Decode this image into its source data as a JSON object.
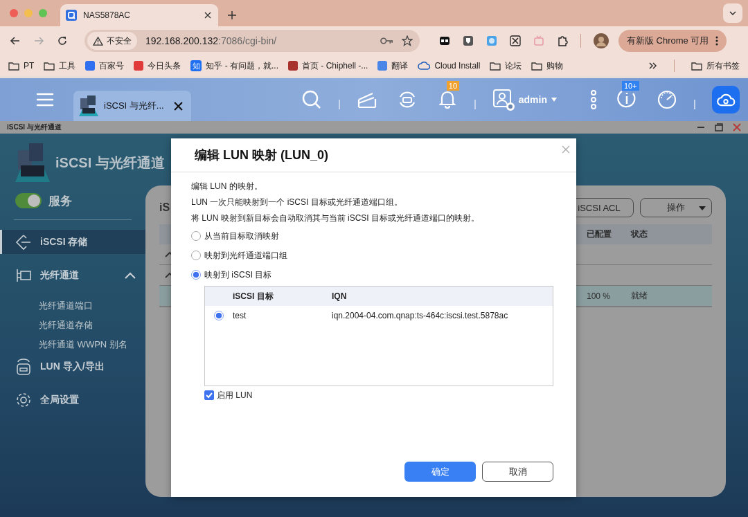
{
  "browser": {
    "tab_title": "NAS5878AC",
    "security_label": "不安全",
    "url_host": "192.168.200.132",
    "url_path": ":7086/cgi-bin/",
    "update_button": "有新版 Chrome 可用",
    "all_bookmarks": "所有书签",
    "bookmarks": [
      {
        "label": "PT",
        "kind": "folder"
      },
      {
        "label": "工具",
        "kind": "folder"
      },
      {
        "label": "百家号",
        "kind": "site",
        "color": "#2f6ff0"
      },
      {
        "label": "今日头条",
        "kind": "site",
        "color": "#e03a3a"
      },
      {
        "label": "知乎 - 有问题，就...",
        "kind": "site",
        "color": "#1f6ff2",
        "glyph": "知"
      },
      {
        "label": "首页 - Chiphell -...",
        "kind": "site",
        "color": "#a8322e"
      },
      {
        "label": "翻译",
        "kind": "site",
        "color": "#4a86e8"
      },
      {
        "label": "Cloud Install",
        "kind": "cloud"
      },
      {
        "label": "论坛",
        "kind": "folder"
      },
      {
        "label": "购物",
        "kind": "folder"
      }
    ]
  },
  "qnap_bar": {
    "tab_label": "iSCSI 与光纤...",
    "notifications": "10",
    "user": "admin",
    "updates": "10+"
  },
  "window": {
    "title": "iSCSI 与光纤通道"
  },
  "sidebar": {
    "app_title": "iSCSI 与光纤通道",
    "service_label": "服务",
    "service_on": true,
    "items": [
      {
        "label": "iSCSI 存储",
        "kind": "iscsi",
        "selected": true
      },
      {
        "label": "光纤通道",
        "kind": "fibre",
        "selected": false,
        "expanded": true,
        "children": [
          {
            "label": "光纤通道端口",
            "selected": false
          },
          {
            "label": "光纤通道存储",
            "selected": false
          },
          {
            "label": "光纤通道 WWPN 别名",
            "selected": false
          }
        ]
      },
      {
        "label": "LUN 导入/导出",
        "kind": "lun",
        "selected": false
      },
      {
        "label": "全局设置",
        "kind": "settings",
        "selected": false
      }
    ]
  },
  "panel": {
    "title": "iS",
    "buttons": [
      {
        "label": "iSCSI ACL",
        "kind": "button"
      },
      {
        "label": "操作",
        "kind": "dropdown"
      }
    ],
    "columns": [
      "已配置",
      "状态"
    ],
    "rows": [
      {
        "kind": "group",
        "selected": false
      },
      {
        "kind": "group",
        "selected": false
      },
      {
        "kind": "lun",
        "selected": true,
        "allocated": "100 %",
        "status": "就绪"
      }
    ]
  },
  "dialog": {
    "title": "编辑 LUN 映射 (LUN_0)",
    "paragraphs": [
      "编辑 LUN 的映射。",
      "LUN 一次只能映射到一个 iSCSI 目标或光纤通道端口组。",
      "将 LUN 映射到新目标会自动取消其与当前 iSCSI 目标或光纤通道端口的映射。"
    ],
    "options": [
      {
        "label": "从当前目标取消映射",
        "selected": false
      },
      {
        "label": "映射到光纤通道端口组",
        "selected": false
      },
      {
        "label": "映射到 iSCSI 目标",
        "selected": true
      }
    ],
    "targets": {
      "columns": [
        "iSCSI 目标",
        "IQN"
      ],
      "rows": [
        {
          "name": "test",
          "iqn": "iqn.2004-04.com.qnap:ts-464c:iscsi.test.5878ac",
          "selected": true
        }
      ]
    },
    "enable_lun": {
      "label": "启用 LUN",
      "checked": true
    },
    "buttons": [
      {
        "label": "确定",
        "kind": "primary"
      },
      {
        "label": "取消",
        "kind": "secondary"
      }
    ]
  }
}
